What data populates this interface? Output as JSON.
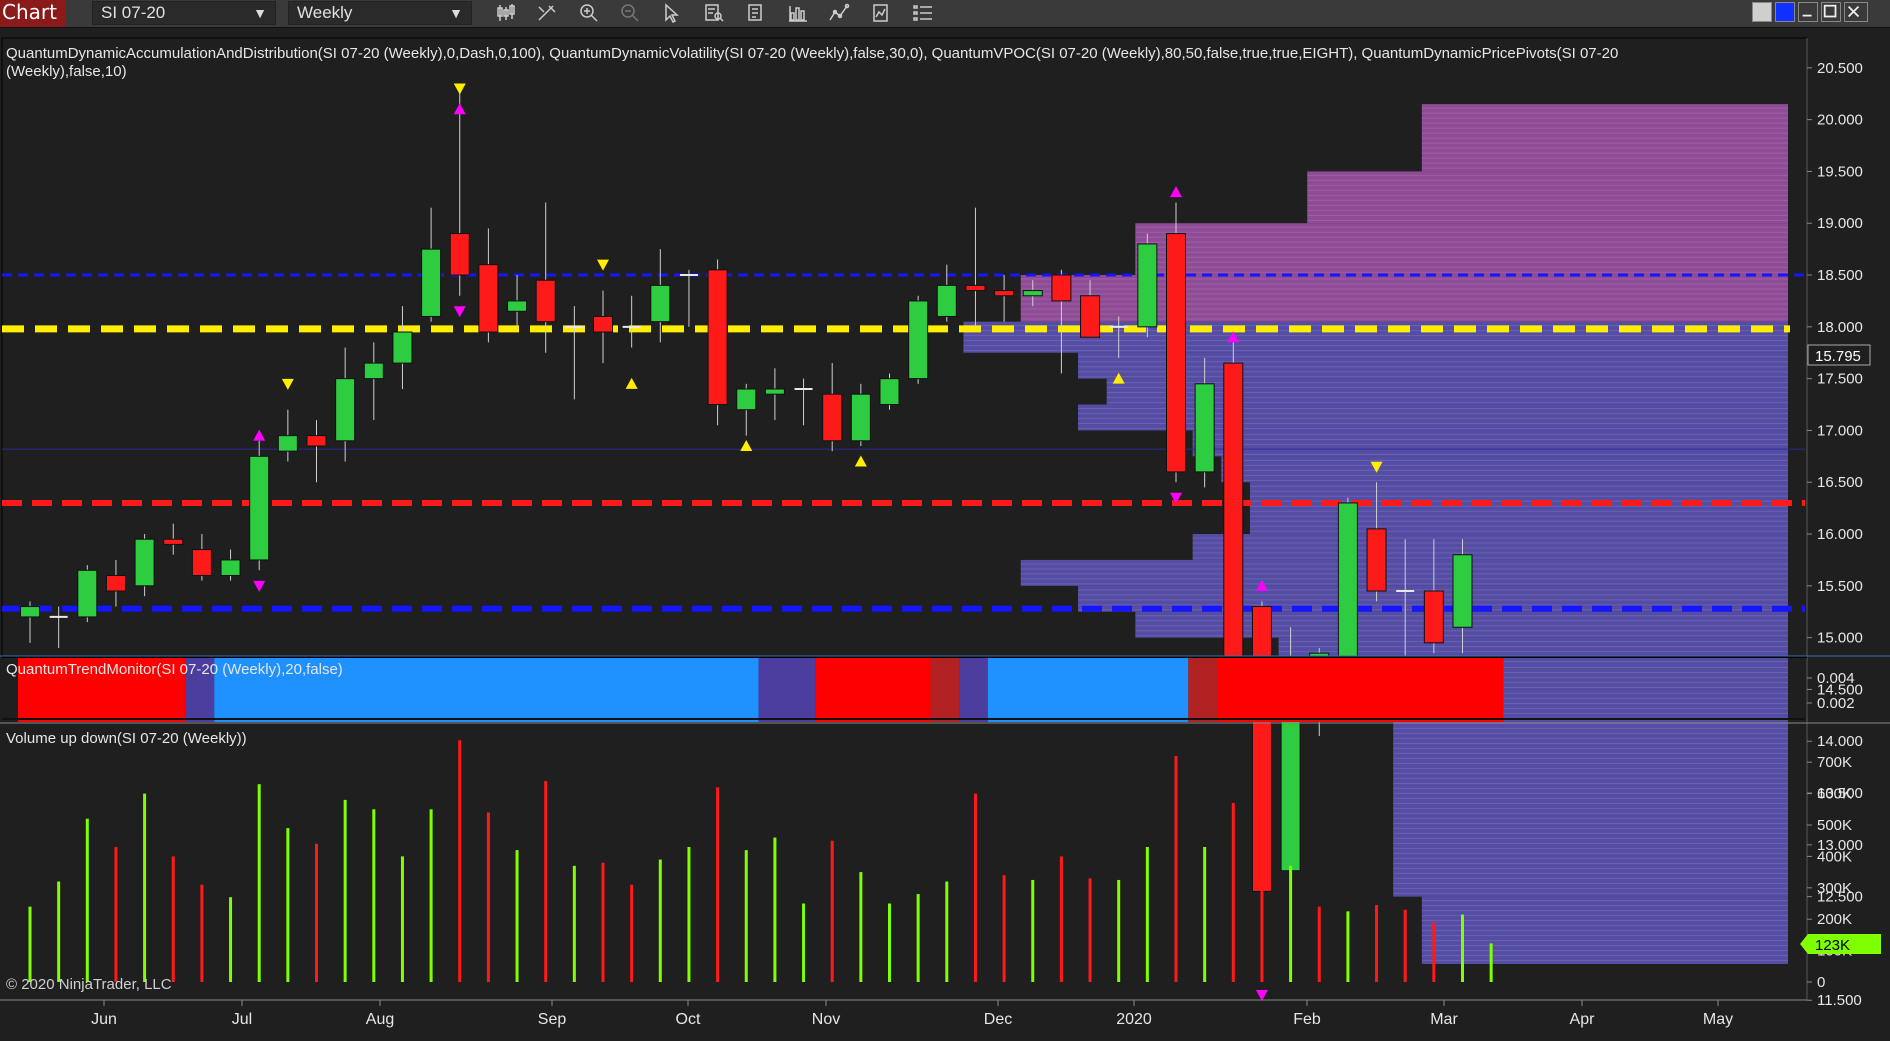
{
  "toolbar": {
    "tab_label": "Chart",
    "instrument": "SI 07-20",
    "interval": "Weekly",
    "icons": [
      "bar-type-icon",
      "draw-icon",
      "zoom-in-icon",
      "zoom-out-icon",
      "select-icon",
      "data-box-icon",
      "properties-icon",
      "strategies-icon",
      "indicators-icon",
      "templates-icon",
      "more-icon"
    ]
  },
  "colors": {
    "background": "#1f1f1f",
    "up_candle": "#2ecc40",
    "down_candle": "#ff1a1a",
    "volume_up": "#7fff00",
    "volume_down": "#ff1a1a",
    "trend_blue": "#1e90ff",
    "trend_red": "#ff0000",
    "trend_purple": "#4b3e9e",
    "poc_line": "#ffee00",
    "resistance_line": "#ff1a1a",
    "support_line": "#1515ff"
  },
  "indicators_label": "QuantumDynamicAccumulationAndDistribution(SI 07-20 (Weekly),0,Dash,0,100), QuantumDynamicVolatility(SI 07-20 (Weekly),false,30,0), QuantumVPOC(SI 07-20 (Weekly),80,50,false,true,true,EIGHT), QuantumDynamicPricePivots(SI 07-20",
  "indicators_label_line2": "(Weekly),false,10)",
  "trend_label": "QuantumTrendMonitor(SI 07-20 (Weekly),20,false)",
  "volume_label": "Volume up down(SI 07-20 (Weekly))",
  "copyright": "© 2020 NinjaTrader, LLC",
  "last_price": "15.795",
  "last_volume": "123K",
  "chart_data": [
    {
      "type": "candlestick",
      "ylim": [
        11.2,
        20.6
      ],
      "price_ticks": [
        "20.500",
        "20.000",
        "19.500",
        "19.000",
        "18.500",
        "18.000",
        "17.500",
        "17.000",
        "16.500",
        "16.000",
        "15.500",
        "15.000",
        "14.500",
        "14.000",
        "13.500",
        "13.000",
        "12.500",
        "12.000",
        "11.500"
      ],
      "x_labels": [
        "Jun",
        "Jul",
        "Aug",
        "Sep",
        "Oct",
        "Nov",
        "Dec",
        "2020",
        "Feb",
        "Mar",
        "Apr",
        "May"
      ],
      "candles": [
        {
          "o": 15.2,
          "h": 15.35,
          "l": 14.95,
          "c": 15.3
        },
        {
          "o": 15.2,
          "h": 15.3,
          "l": 14.9,
          "c": 15.2
        },
        {
          "o": 15.2,
          "h": 15.7,
          "l": 15.15,
          "c": 15.65
        },
        {
          "o": 15.6,
          "h": 15.75,
          "l": 15.3,
          "c": 15.45
        },
        {
          "o": 15.5,
          "h": 16.0,
          "l": 15.4,
          "c": 15.95
        },
        {
          "o": 15.95,
          "h": 16.1,
          "l": 15.8,
          "c": 15.9
        },
        {
          "o": 15.85,
          "h": 16.0,
          "l": 15.55,
          "c": 15.6
        },
        {
          "o": 15.6,
          "h": 15.85,
          "l": 15.55,
          "c": 15.75
        },
        {
          "o": 15.75,
          "h": 16.9,
          "l": 15.65,
          "c": 16.75
        },
        {
          "o": 16.8,
          "h": 17.2,
          "l": 16.7,
          "c": 16.95
        },
        {
          "o": 16.95,
          "h": 17.1,
          "l": 16.5,
          "c": 16.85
        },
        {
          "o": 16.9,
          "h": 17.8,
          "l": 16.7,
          "c": 17.5
        },
        {
          "o": 17.5,
          "h": 17.85,
          "l": 17.1,
          "c": 17.65
        },
        {
          "o": 17.65,
          "h": 18.2,
          "l": 17.4,
          "c": 17.95
        },
        {
          "o": 18.1,
          "h": 19.15,
          "l": 18.05,
          "c": 18.75
        },
        {
          "o": 18.9,
          "h": 20.3,
          "l": 18.3,
          "c": 18.5
        },
        {
          "o": 18.6,
          "h": 18.95,
          "l": 17.85,
          "c": 17.95
        },
        {
          "o": 18.15,
          "h": 18.5,
          "l": 18.0,
          "c": 18.25
        },
        {
          "o": 18.45,
          "h": 19.2,
          "l": 17.75,
          "c": 18.05
        },
        {
          "o": 18.0,
          "h": 18.2,
          "l": 17.3,
          "c": 18.0
        },
        {
          "o": 18.1,
          "h": 18.35,
          "l": 17.65,
          "c": 17.95
        },
        {
          "o": 18.0,
          "h": 18.3,
          "l": 17.8,
          "c": 18.0
        },
        {
          "o": 18.05,
          "h": 18.75,
          "l": 17.85,
          "c": 18.4
        },
        {
          "o": 18.5,
          "h": 18.55,
          "l": 18.0,
          "c": 18.5
        },
        {
          "o": 18.55,
          "h": 18.65,
          "l": 17.05,
          "c": 17.25
        },
        {
          "o": 17.2,
          "h": 17.45,
          "l": 16.95,
          "c": 17.4
        },
        {
          "o": 17.35,
          "h": 17.6,
          "l": 17.1,
          "c": 17.4
        },
        {
          "o": 17.4,
          "h": 17.5,
          "l": 17.05,
          "c": 17.4
        },
        {
          "o": 17.35,
          "h": 17.65,
          "l": 16.8,
          "c": 16.9
        },
        {
          "o": 16.9,
          "h": 17.45,
          "l": 16.85,
          "c": 17.35
        },
        {
          "o": 17.25,
          "h": 17.55,
          "l": 17.2,
          "c": 17.5
        },
        {
          "o": 17.5,
          "h": 18.3,
          "l": 17.45,
          "c": 18.25
        },
        {
          "o": 18.1,
          "h": 18.6,
          "l": 18.05,
          "c": 18.4
        },
        {
          "o": 18.4,
          "h": 19.15,
          "l": 18.0,
          "c": 18.35
        },
        {
          "o": 18.35,
          "h": 18.5,
          "l": 18.05,
          "c": 18.3
        },
        {
          "o": 18.3,
          "h": 18.45,
          "l": 18.2,
          "c": 18.35
        },
        {
          "o": 18.5,
          "h": 18.55,
          "l": 17.55,
          "c": 18.25
        },
        {
          "o": 18.3,
          "h": 18.45,
          "l": 17.9,
          "c": 17.9
        },
        {
          "o": 18.0,
          "h": 18.1,
          "l": 17.7,
          "c": 18.0
        },
        {
          "o": 18.0,
          "h": 18.9,
          "l": 17.9,
          "c": 18.8
        },
        {
          "o": 18.9,
          "h": 19.2,
          "l": 16.5,
          "c": 16.6
        },
        {
          "o": 16.6,
          "h": 17.7,
          "l": 16.45,
          "c": 17.45
        },
        {
          "o": 17.65,
          "h": 17.85,
          "l": 14.6,
          "c": 14.65
        },
        {
          "o": 15.3,
          "h": 15.35,
          "l": 11.8,
          "c": 12.55
        },
        {
          "o": 12.75,
          "h": 15.1,
          "l": 12.5,
          "c": 14.7
        },
        {
          "o": 14.7,
          "h": 14.9,
          "l": 14.05,
          "c": 14.85
        },
        {
          "o": 14.8,
          "h": 16.35,
          "l": 14.55,
          "c": 16.3
        },
        {
          "o": 16.05,
          "h": 16.5,
          "l": 15.35,
          "c": 15.45
        },
        {
          "o": 15.45,
          "h": 15.95,
          "l": 14.75,
          "c": 15.45
        },
        {
          "o": 15.45,
          "h": 15.95,
          "l": 14.85,
          "c": 14.95
        },
        {
          "o": 15.1,
          "h": 15.95,
          "l": 14.85,
          "c": 15.8
        }
      ],
      "horizontal_levels": {
        "support_blue_upper": 18.5,
        "poc_yellow": 17.98,
        "resistance_red": 16.3,
        "support_blue_lower": 15.28
      },
      "pivot_markers": [
        {
          "bar": 8,
          "price": 16.95,
          "dir": "up",
          "color": "magenta"
        },
        {
          "bar": 8,
          "price": 15.5,
          "dir": "down",
          "color": "magenta"
        },
        {
          "bar": 9,
          "price": 17.45,
          "dir": "down",
          "color": "yellow"
        },
        {
          "bar": 15,
          "price": 20.3,
          "dir": "down",
          "color": "yellow"
        },
        {
          "bar": 15,
          "price": 20.1,
          "dir": "up",
          "color": "magenta"
        },
        {
          "bar": 15,
          "price": 18.15,
          "dir": "down",
          "color": "magenta"
        },
        {
          "bar": 20,
          "price": 18.6,
          "dir": "down",
          "color": "yellow"
        },
        {
          "bar": 21,
          "price": 17.45,
          "dir": "up",
          "color": "yellow"
        },
        {
          "bar": 25,
          "price": 16.85,
          "dir": "up",
          "color": "yellow"
        },
        {
          "bar": 29,
          "price": 16.7,
          "dir": "up",
          "color": "yellow"
        },
        {
          "bar": 38,
          "price": 17.5,
          "dir": "up",
          "color": "yellow"
        },
        {
          "bar": 40,
          "price": 19.3,
          "dir": "up",
          "color": "magenta"
        },
        {
          "bar": 40,
          "price": 16.35,
          "dir": "down",
          "color": "magenta"
        },
        {
          "bar": 42,
          "price": 17.9,
          "dir": "up",
          "color": "magenta"
        },
        {
          "bar": 42,
          "price": 14.45,
          "dir": "down",
          "color": "magenta"
        },
        {
          "bar": 43,
          "price": 15.5,
          "dir": "up",
          "color": "magenta"
        },
        {
          "bar": 43,
          "price": 11.55,
          "dir": "down",
          "color": "magenta"
        },
        {
          "bar": 47,
          "price": 16.65,
          "dir": "down",
          "color": "yellow"
        }
      ],
      "vpoc_profile": [
        {
          "low": 19.5,
          "high": 20.15,
          "start_bar": 49
        },
        {
          "low": 19.0,
          "high": 19.5,
          "start_bar": 45
        },
        {
          "low": 18.5,
          "high": 19.0,
          "start_bar": 39
        },
        {
          "low": 18.05,
          "high": 18.5,
          "start_bar": 35
        },
        {
          "low": 17.75,
          "high": 18.05,
          "start_bar": 33
        },
        {
          "low": 17.5,
          "high": 17.75,
          "start_bar": 37
        },
        {
          "low": 17.25,
          "high": 17.5,
          "start_bar": 38
        },
        {
          "low": 17.0,
          "high": 17.25,
          "start_bar": 37
        },
        {
          "low": 16.75,
          "high": 17.0,
          "start_bar": 41
        },
        {
          "low": 16.5,
          "high": 16.75,
          "start_bar": 42
        },
        {
          "low": 16.0,
          "high": 16.5,
          "start_bar": 43
        },
        {
          "low": 15.75,
          "high": 16.0,
          "start_bar": 41
        },
        {
          "low": 15.5,
          "high": 15.75,
          "start_bar": 35
        },
        {
          "low": 15.25,
          "high": 15.5,
          "start_bar": 37
        },
        {
          "low": 15.0,
          "high": 15.25,
          "start_bar": 39
        },
        {
          "low": 14.75,
          "high": 15.0,
          "start_bar": 44
        },
        {
          "low": 14.5,
          "high": 14.75,
          "start_bar": 46
        },
        {
          "low": 12.5,
          "high": 14.5,
          "start_bar": 48
        },
        {
          "low": 11.85,
          "high": 12.5,
          "start_bar": 49
        }
      ]
    },
    {
      "type": "heatmap",
      "name": "QuantumTrendMonitor",
      "value_ticks": [
        "0.004",
        "0.002"
      ],
      "segments": [
        {
          "from": 0,
          "to": 5,
          "state": "red"
        },
        {
          "from": 6,
          "to": 6,
          "state": "purple"
        },
        {
          "from": 7,
          "to": 25,
          "state": "blue"
        },
        {
          "from": 26,
          "to": 27,
          "state": "purple"
        },
        {
          "from": 28,
          "to": 31,
          "state": "red"
        },
        {
          "from": 32,
          "to": 32,
          "state": "darkred"
        },
        {
          "from": 33,
          "to": 33,
          "state": "purple"
        },
        {
          "from": 34,
          "to": 40,
          "state": "blue"
        },
        {
          "from": 41,
          "to": 41,
          "state": "darkred"
        },
        {
          "from": 42,
          "to": 51,
          "state": "red"
        }
      ]
    },
    {
      "type": "bar",
      "name": "Volume up down",
      "ylim": [
        0,
        780000
      ],
      "tick_labels": [
        "700K",
        "600K",
        "500K",
        "400K",
        "300K",
        "200K",
        "100K",
        "0"
      ],
      "values": [
        240000,
        320000,
        520000,
        430000,
        600000,
        400000,
        310000,
        270000,
        630000,
        490000,
        440000,
        580000,
        550000,
        400000,
        550000,
        770000,
        540000,
        420000,
        640000,
        370000,
        380000,
        310000,
        390000,
        430000,
        620000,
        420000,
        460000,
        250000,
        450000,
        350000,
        250000,
        280000,
        320000,
        600000,
        340000,
        325000,
        400000,
        330000,
        325000,
        430000,
        720000,
        430000,
        570000,
        540000,
        370000,
        240000,
        225000,
        245000,
        230000,
        190000,
        215000,
        123000
      ],
      "directions": [
        "up",
        "up",
        "up",
        "down",
        "up",
        "down",
        "down",
        "up",
        "up",
        "up",
        "down",
        "up",
        "up",
        "up",
        "up",
        "down",
        "down",
        "up",
        "down",
        "up",
        "down",
        "down",
        "up",
        "up",
        "down",
        "up",
        "up",
        "up",
        "down",
        "up",
        "up",
        "up",
        "up",
        "down",
        "down",
        "up",
        "down",
        "down",
        "up",
        "up",
        "down",
        "up",
        "down",
        "down",
        "up",
        "down",
        "up",
        "down",
        "down",
        "down",
        "up",
        "up"
      ]
    }
  ]
}
